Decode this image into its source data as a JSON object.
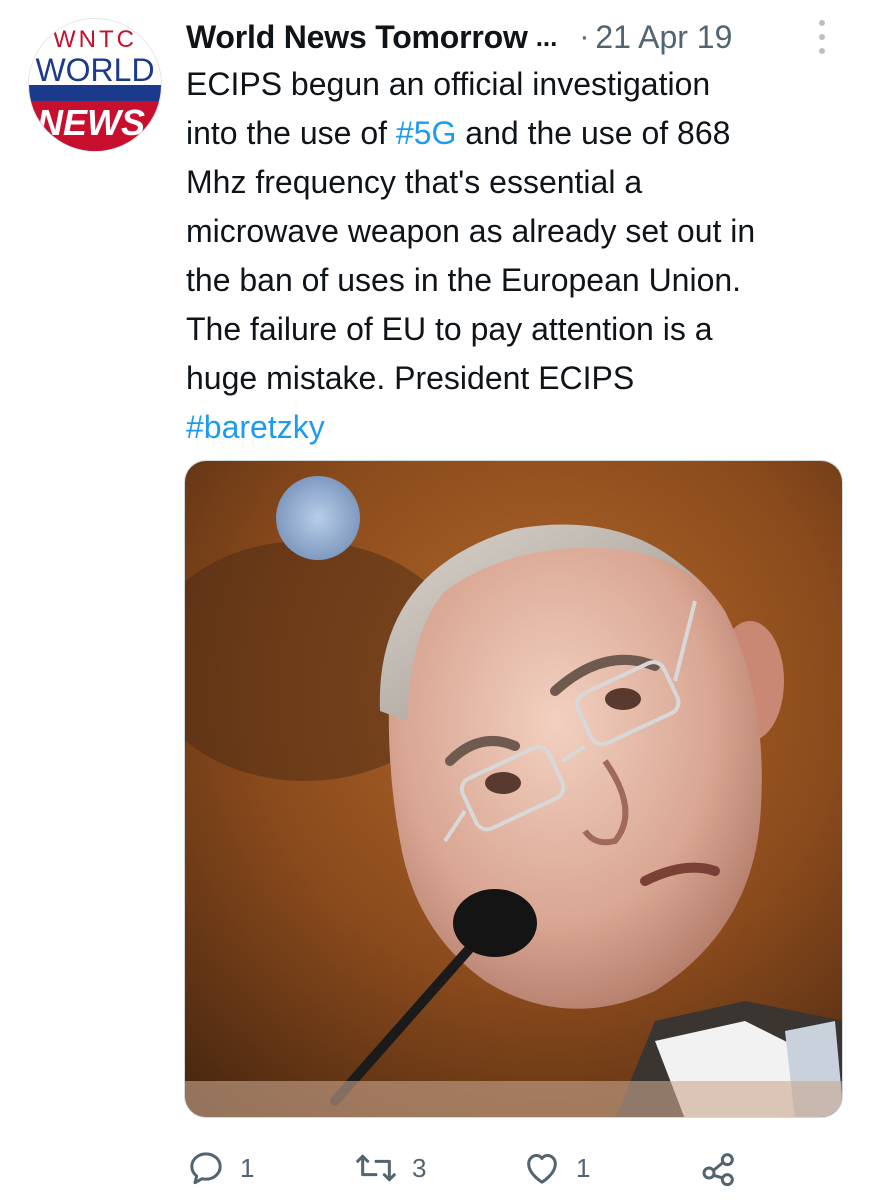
{
  "tweet": {
    "author": {
      "display_name": "World News Tomorrow",
      "truncation": "...",
      "avatar_text": {
        "top": "WNTC",
        "middle": "WORLD",
        "bottom": "NEWS"
      }
    },
    "separator": "·",
    "date": "21 Apr 19",
    "text_lines": [
      {
        "parts": [
          {
            "text": "ECIPS begun an official investigation",
            "type": "text"
          }
        ]
      },
      {
        "parts": [
          {
            "text": "into the use of ",
            "type": "text"
          },
          {
            "text": "#5G",
            "type": "hashtag"
          },
          {
            "text": " and the use of 868",
            "type": "text"
          }
        ]
      },
      {
        "parts": [
          {
            "text": "Mhz frequency that's essential a",
            "type": "text"
          }
        ]
      },
      {
        "parts": [
          {
            "text": "microwave weapon as already set out in",
            "type": "text"
          }
        ]
      },
      {
        "parts": [
          {
            "text": "the ban of uses in the European Union.",
            "type": "text"
          }
        ]
      },
      {
        "parts": [
          {
            "text": "The failure of EU to pay attention is a",
            "type": "text"
          }
        ]
      },
      {
        "parts": [
          {
            "text": "huge mistake. President ECIPS",
            "type": "text"
          }
        ]
      },
      {
        "parts": [
          {
            "text": "#baretzky",
            "type": "hashtag"
          }
        ]
      }
    ],
    "actions": {
      "reply": {
        "count": "1",
        "icon": "reply-icon"
      },
      "retweet": {
        "count": "3",
        "icon": "retweet-icon"
      },
      "like": {
        "count": "1",
        "icon": "heart-icon"
      },
      "share": {
        "icon": "share-icon"
      }
    },
    "colors": {
      "text": "#0f1419",
      "secondary": "#536471",
      "link": "#1d9bf0",
      "avatar_red": "#c8102e",
      "avatar_blue": "#1b3a8c"
    }
  }
}
